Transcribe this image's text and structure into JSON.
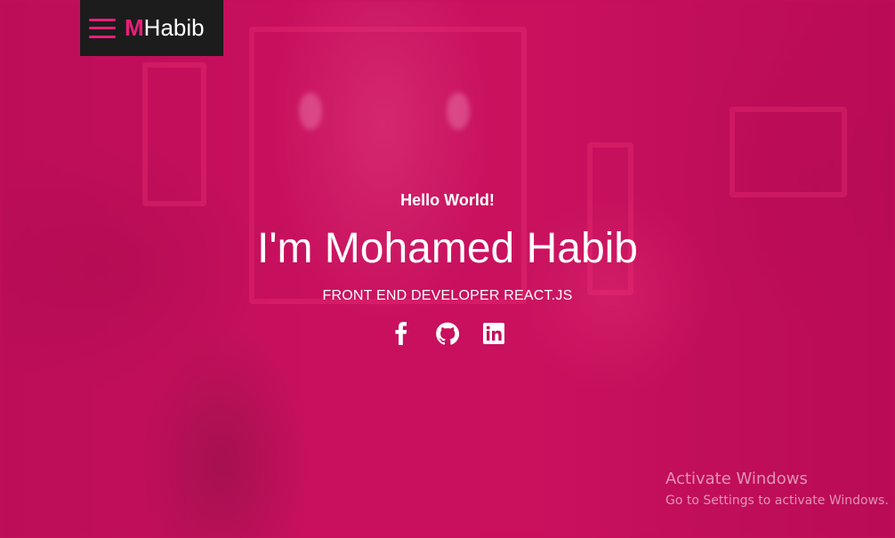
{
  "nav": {
    "logo_accent": "M",
    "logo_rest": "Habib",
    "menu_icon": "hamburger-icon"
  },
  "hero": {
    "greeting": "Hello World!",
    "name": "I'm Mohamed Habib",
    "role": "FRONT END DEVELOPER REACT.JS",
    "socials": [
      {
        "icon": "facebook-icon"
      },
      {
        "icon": "github-icon"
      },
      {
        "icon": "linkedin-icon"
      }
    ]
  },
  "system": {
    "activate_title": "Activate Windows",
    "activate_sub": "Go to Settings to activate Windows."
  },
  "colors": {
    "accent": "#e91e7a",
    "background": "#c2105a",
    "brand_bg": "#1c1c1c"
  }
}
